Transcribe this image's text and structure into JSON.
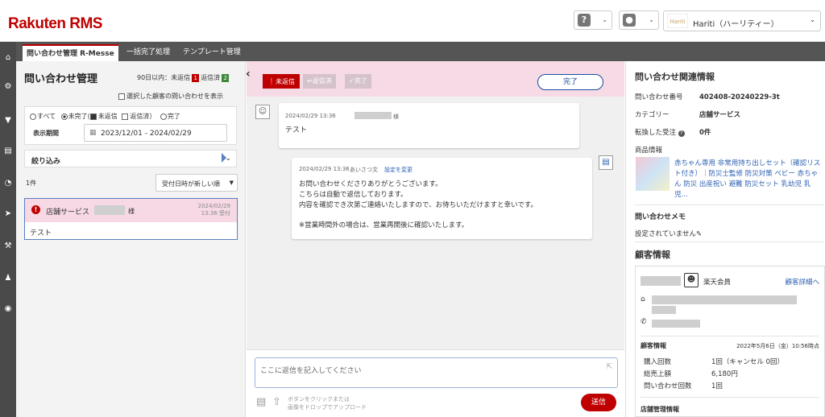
{
  "app": {
    "logo": "Rakuten RMS",
    "shop_logo": "Hariti",
    "shop_name": "Hariti（ハーリティー）"
  },
  "tabs": [
    {
      "label": "問い合わせ管理 R-Messe"
    },
    {
      "label": "一括完了処理"
    },
    {
      "label": "テンプレート管理"
    }
  ],
  "left": {
    "title": "問い合わせ管理",
    "count_prefix": "90日以内：未返信",
    "unreplied": "1",
    "replied_label": "返信済",
    "replied": "2",
    "show_selected": "選択した顧客の問い合わせを表示",
    "filter": {
      "all": "すべて",
      "incomplete": "未完了(",
      "unreplied": "未返信",
      "replied": "返信済）",
      "complete": "完了"
    },
    "period_label": "表示期間",
    "period_value": "2023/12/01 - 2024/02/29",
    "narrow_label": "絞り込み",
    "result_count": "1件",
    "sort_value": "受付日時が新しい順",
    "item": {
      "category": "店舗サービス",
      "sama": "様",
      "date": "2024/02/29",
      "time": "13:36 受付",
      "body": "テスト"
    }
  },
  "center": {
    "status_unreplied": "未返信",
    "status_replied": "返信済",
    "status_done": "完了",
    "done_button": "完了",
    "msg1": {
      "meta": "2024/02/29 13:36",
      "sama": "様",
      "body": "テスト"
    },
    "msg2": {
      "meta": "2024/02/29 13:36",
      "greet": "あいさつ文",
      "setting": "設定を変更",
      "line1": "お問い合わせくださりありがとうございます。",
      "line2": "こちらは自動で返信しております。",
      "line3": "内容を確認でき次第ご連絡いたしますので、お待ちいただけますと幸いです。",
      "line4": "※営業時間外の場合は、営業再開後に確認いたします。"
    },
    "reply_placeholder": "ここに返信を記入してください",
    "attach_line1": "ボタンをクリックまたは",
    "attach_line2": "画像をドロップでアップロード",
    "send": "送信"
  },
  "right": {
    "title": "問い合わせ関連情報",
    "inq_no_label": "問い合わせ番号",
    "inq_no": "402408-20240229-3t",
    "category_label": "カテゴリー",
    "category": "店舗サービス",
    "order_label": "転換した受注",
    "order": "0件",
    "product_label": "商品情報",
    "product_name": "赤ちゃん専用 非常用持ち出しセット（確認リスト付き）｜防災士監修 防災対策 ベビー 赤ちゃん 防災 出産祝い 避難 防災セット 乳幼児 乳児...",
    "memo_title": "問い合わせメモ",
    "memo_text": "設定されていません",
    "customer_title": "顧客情報",
    "member": "楽天会員",
    "detail_link": "顧客詳細へ",
    "cust_info": "顧客情報",
    "cust_date": "2022年5月6日（金）10:56時点",
    "purchases_label": "購入回数",
    "purchases": "1回（キャンセル 0回）",
    "total_label": "総売上額",
    "total": "6,180円",
    "inq_count_label": "問い合わせ回数",
    "inq_count": "1回",
    "store_info": "店舗管理情報"
  },
  "colors": {
    "brand": "#bf0000",
    "badge_unreplied": "#bf0000",
    "badge_replied": "#3a8a3a",
    "link": "#2b5fb3"
  }
}
